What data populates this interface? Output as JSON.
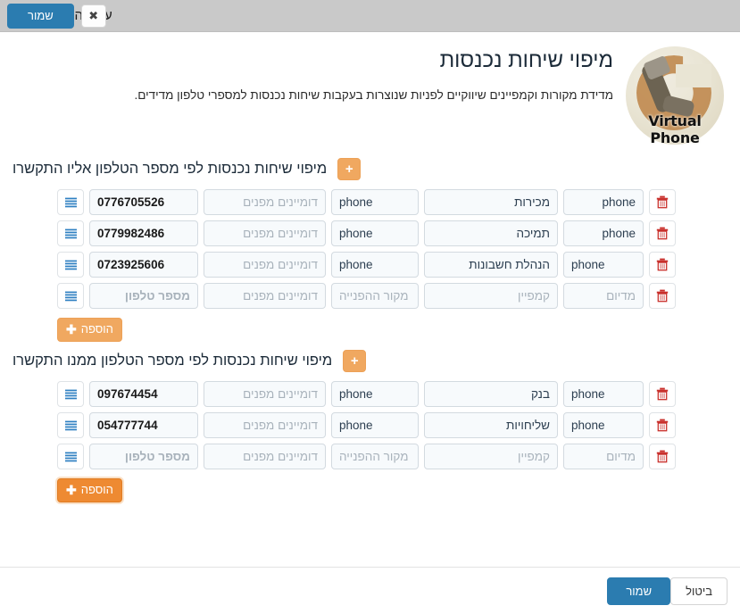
{
  "window": {
    "title": "ערוך הגדרות חיבור",
    "save_label": "שמור",
    "close_label": "✖"
  },
  "brand": {
    "logo_text": "Virtual Phone"
  },
  "header": {
    "title": "מיפוי שיחות נכנסות",
    "description": "מדידת מקורות וקמפיינים שיווקיים לפניות שנוצרות בעקבות שיחות נכנסות למספרי טלפון מדידים."
  },
  "placeholders": {
    "phone_number": "מספר טלפון",
    "referring_domains": "דומיינים מפנים",
    "referral_source": "מקור ההפנייה",
    "campaign": "קמפיין",
    "medium": "מדיום"
  },
  "icons": {
    "delete": "trash-icon",
    "menu": "hamburger-icon",
    "plus": "plus-icon"
  },
  "sections": [
    {
      "title": "מיפוי שיחות נכנסות לפי מספר הטלפון אליו התקשרו",
      "add_plus_label": "+",
      "add_button_label": "הוספה",
      "add_button_plus": "✚",
      "add_button_active": false,
      "rows": [
        {
          "phone_number": "0776705526",
          "referring_domains": "",
          "referral_source": "phone",
          "campaign": "מכירות",
          "medium": "phone",
          "medium_align": "rtl"
        },
        {
          "phone_number": "0779982486",
          "referring_domains": "",
          "referral_source": "phone",
          "campaign": "תמיכה",
          "medium": "phone",
          "medium_align": "rtl"
        },
        {
          "phone_number": "0723925606",
          "referring_domains": "",
          "referral_source": "phone",
          "campaign": "הנהלת חשבונות",
          "medium": "phone",
          "medium_align": "ltr"
        },
        {
          "phone_number": "",
          "referring_domains": "",
          "referral_source": "",
          "campaign": "",
          "medium": "",
          "medium_align": "rtl"
        }
      ]
    },
    {
      "title": "מיפוי שיחות נכנסות לפי מספר הטלפון ממנו התקשרו",
      "add_plus_label": "+",
      "add_button_label": "הוספה",
      "add_button_plus": "✚",
      "add_button_active": true,
      "rows": [
        {
          "phone_number": "097674454",
          "referring_domains": "",
          "referral_source": "phone",
          "campaign": "בנק",
          "medium": "phone",
          "medium_align": "ltr"
        },
        {
          "phone_number": "054777744",
          "referring_domains": "",
          "referral_source": "phone",
          "campaign": "שליחויות",
          "medium": "phone",
          "medium_align": "ltr"
        },
        {
          "phone_number": "",
          "referring_domains": "",
          "referral_source": "",
          "campaign": "",
          "medium": "",
          "medium_align": "rtl"
        }
      ]
    }
  ],
  "footer": {
    "cancel_label": "ביטול",
    "save_label": "שמור"
  },
  "colors": {
    "accent_blue": "#2b7cb0",
    "accent_orange": "#f0a860",
    "orange_active": "#ee8a32",
    "danger_red": "#c9302c",
    "topbar_gray": "#c9c9c9"
  }
}
